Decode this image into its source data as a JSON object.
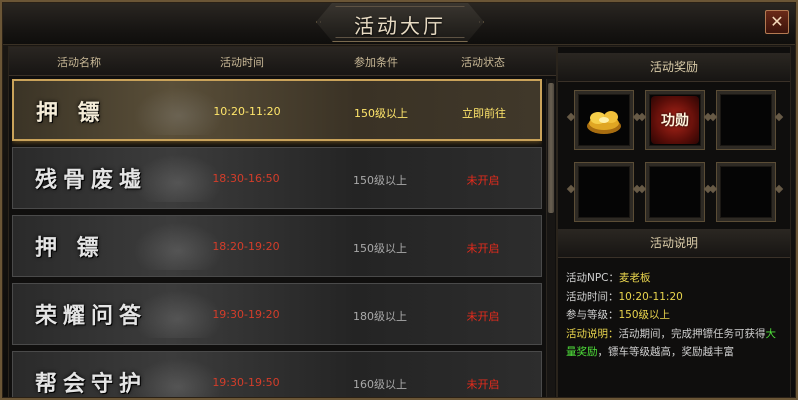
{
  "window": {
    "title": "活动大厅",
    "close_label": "✕",
    "accent": "#caa35a"
  },
  "list": {
    "headers": [
      "活动名称",
      "活动时间",
      "参加条件",
      "活动状态"
    ],
    "rows": [
      {
        "name": "押  镖",
        "time": "10:20-11:20",
        "condition": "150级以上",
        "status": "立即前往",
        "selected": true
      },
      {
        "name": "残骨废墟",
        "time": "18:30-16:50",
        "condition": "150级以上",
        "status": "未开启",
        "selected": false
      },
      {
        "name": "押  镖",
        "time": "18:20-19:20",
        "condition": "150级以上",
        "status": "未开启",
        "selected": false
      },
      {
        "name": "荣耀问答",
        "time": "19:30-19:20",
        "condition": "180级以上",
        "status": "未开启",
        "selected": false
      },
      {
        "name": "帮会守护",
        "time": "19:30-19:50",
        "condition": "160级以上",
        "status": "未开启",
        "selected": false
      }
    ]
  },
  "rewards": {
    "header": "活动奖励",
    "merit_label": "功勋",
    "slot_icons": [
      "gold-ingot-icon",
      "merit-icon",
      "empty-slot",
      "empty-slot",
      "empty-slot",
      "empty-slot"
    ]
  },
  "description": {
    "header": "活动说明",
    "npc_label": "活动NPC：",
    "npc_value": "麦老板",
    "time_label": "活动时间：",
    "time_value": "10:20-11:20",
    "level_label": "参与等级：",
    "level_value": "150级以上",
    "desc_label": "活动说明：",
    "desc_text_1": "活动期间，完成押镖任务可获得",
    "desc_highlight_1": "大",
    "desc_highlight_2": "量奖励",
    "desc_text_2": "，镖车等级越高，奖励越丰富"
  }
}
